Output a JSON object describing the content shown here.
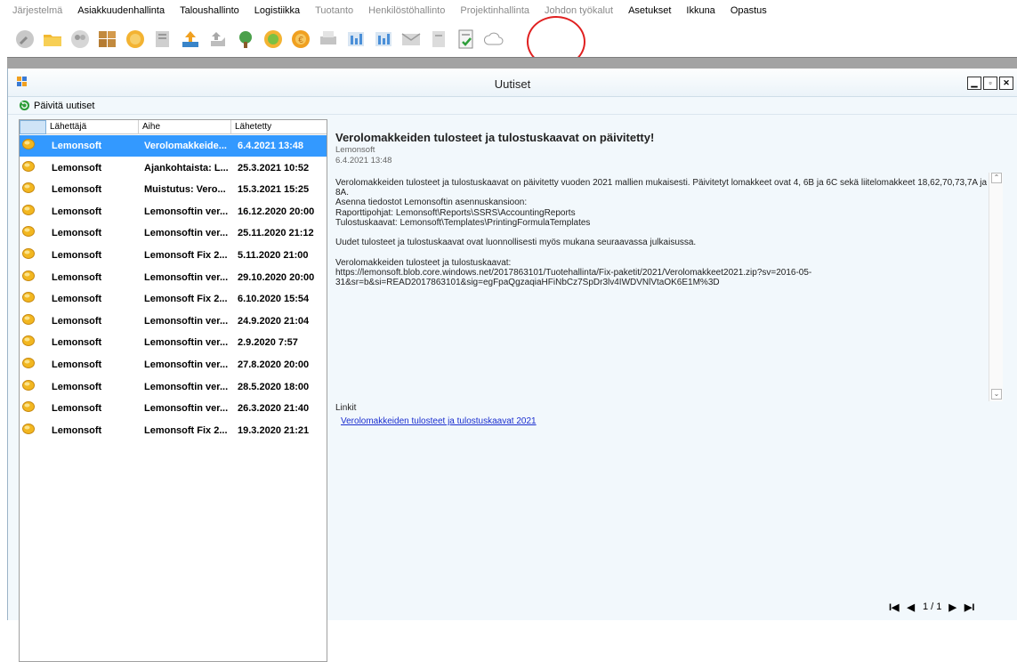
{
  "menubar": {
    "items": [
      {
        "label": "Järjestelmä",
        "dim": true
      },
      {
        "label": "Asiakkuudenhallinta",
        "dim": false
      },
      {
        "label": "Taloushallinto",
        "dim": false
      },
      {
        "label": "Logistiikka",
        "dim": false
      },
      {
        "label": "Tuotanto",
        "dim": true
      },
      {
        "label": "Henkilöstöhallinto",
        "dim": true
      },
      {
        "label": "Projektinhallinta",
        "dim": true
      },
      {
        "label": "Johdon työkalut",
        "dim": true
      },
      {
        "label": "Asetukset",
        "dim": false
      },
      {
        "label": "Ikkuna",
        "dim": false
      },
      {
        "label": "Opastus",
        "dim": false
      }
    ]
  },
  "toolbar": {
    "icons": [
      "wrench-icon",
      "folder-icon",
      "people-icon",
      "boxes-icon",
      "coins-icon",
      "documents-icon",
      "upload-icon",
      "hand-icon",
      "tree-icon",
      "chart-icon",
      "coin-icon",
      "printer-icon",
      "calc-sheet-icon",
      "calc-sheet-icon",
      "mail-icon",
      "document-icon",
      "checklist-icon",
      "cloud-icon"
    ],
    "highlighted_icon": "checklist-icon",
    "highlight_color": "#e02020"
  },
  "window": {
    "title": "Uutiset",
    "buttons": {
      "minimize": "▁",
      "maximize": "▫",
      "close": "✕"
    },
    "refresh_label": "Päivitä uutiset"
  },
  "list": {
    "columns": [
      "Lähettäjä",
      "Aihe",
      "Lähetetty"
    ],
    "rows": [
      {
        "sender": "Lemonsoft",
        "subject": "Verolomakkeide...",
        "sent": "6.4.2021 13:48",
        "selected": true
      },
      {
        "sender": "Lemonsoft",
        "subject": "Ajankohtaista: L...",
        "sent": "25.3.2021 10:52",
        "selected": false
      },
      {
        "sender": "Lemonsoft",
        "subject": "Muistutus: Vero...",
        "sent": "15.3.2021 15:25",
        "selected": false
      },
      {
        "sender": "Lemonsoft",
        "subject": "Lemonsoftin ver...",
        "sent": "16.12.2020 20:00",
        "selected": false
      },
      {
        "sender": "Lemonsoft",
        "subject": "Lemonsoftin ver...",
        "sent": "25.11.2020 21:12",
        "selected": false
      },
      {
        "sender": "Lemonsoft",
        "subject": "Lemonsoft Fix 2...",
        "sent": "5.11.2020 21:00",
        "selected": false
      },
      {
        "sender": "Lemonsoft",
        "subject": "Lemonsoftin ver...",
        "sent": "29.10.2020 20:00",
        "selected": false
      },
      {
        "sender": "Lemonsoft",
        "subject": "Lemonsoft Fix 2...",
        "sent": "6.10.2020 15:54",
        "selected": false
      },
      {
        "sender": "Lemonsoft",
        "subject": "Lemonsoftin ver...",
        "sent": "24.9.2020 21:04",
        "selected": false
      },
      {
        "sender": "Lemonsoft",
        "subject": "Lemonsoftin ver...",
        "sent": "2.9.2020 7:57",
        "selected": false
      },
      {
        "sender": "Lemonsoft",
        "subject": "Lemonsoftin ver...",
        "sent": "27.8.2020 20:00",
        "selected": false
      },
      {
        "sender": "Lemonsoft",
        "subject": "Lemonsoftin ver...",
        "sent": "28.5.2020 18:00",
        "selected": false
      },
      {
        "sender": "Lemonsoft",
        "subject": "Lemonsoftin ver...",
        "sent": "26.3.2020 21:40",
        "selected": false
      },
      {
        "sender": "Lemonsoft",
        "subject": "Lemonsoft Fix 2...",
        "sent": "19.3.2020 21:21",
        "selected": false
      }
    ]
  },
  "detail": {
    "title": "Verolomakkeiden tulosteet ja tulostuskaavat on päivitetty!",
    "sender": "Lemonsoft",
    "date": "6.4.2021 13:48",
    "body": "Verolomakkeiden tulosteet ja tulostuskaavat on päivitetty vuoden 2021 mallien mukaisesti. Päivitetyt lomakkeet ovat 4, 6B ja 6C sekä liitelomakkeet 18,62,70,73,7A ja\n8A.\nAsenna tiedostot Lemonsoftin asennuskansioon:\nRaporttipohjat: Lemonsoft\\Reports\\SSRS\\AccountingReports\nTulostuskaavat: Lemonsoft\\Templates\\PrintingFormulaTemplates\n\nUudet tulosteet ja tulostuskaavat ovat luonnollisesti myös mukana seuraavassa julkaisussa.\n\nVerolomakkeiden tulosteet ja tulostuskaavat:\nhttps://lemonsoft.blob.core.windows.net/2017863101/Tuotehallinta/Fix-paketit/2021/Verolomakkeet2021.zip?sv=2016-05-\n31&sr=b&si=READ2017863101&sig=egFpaQgzaqiaHFiNbCz7SpDr3lv4IWDVNlVtaOK6E1M%3D",
    "links_label": "Linkit",
    "link_text": "Verolomakkeiden tulosteet ja tulostuskaavat 2021"
  },
  "pager": {
    "first": "I◀",
    "prev": "◀",
    "info": "1 / 1",
    "next": "▶",
    "last": "▶I"
  }
}
